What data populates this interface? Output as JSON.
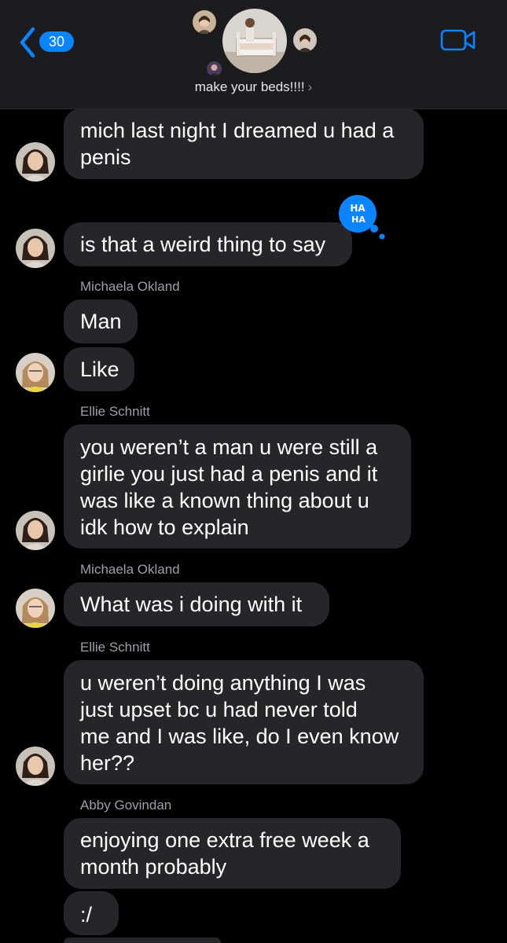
{
  "header": {
    "back_count": "30",
    "group_name": "make your beds!!!!",
    "chevron_glyph": "›"
  },
  "reaction": {
    "line1": "HA",
    "line2": "HA"
  },
  "senders": [
    "Michaela Okland",
    "Ellie Schnitt",
    "Michaela Okland",
    "Ellie Schnitt",
    "Abby Govindan"
  ],
  "messages": [
    {
      "text": "mich last night I dreamed u had a\npenis"
    },
    {
      "text": "is that a weird thing to say"
    },
    {
      "text": "Man"
    },
    {
      "text": "Like"
    },
    {
      "text": "you weren’t a man u were still a\ngirlie you just had a penis and it\nwas like a known thing about u\nidk how to explain"
    },
    {
      "text": "What was i doing with it"
    },
    {
      "text": "u weren’t doing anything I was\njust upset bc u had never told\nme and I was like, do I even know\nher??"
    },
    {
      "text": "enjoying one extra free week a\nmonth probably"
    },
    {
      "text": ":/"
    }
  ],
  "colors": {
    "accent": "#0a84ff",
    "bubble": "#262628",
    "background": "#000000",
    "header": "#1c1c1e"
  }
}
